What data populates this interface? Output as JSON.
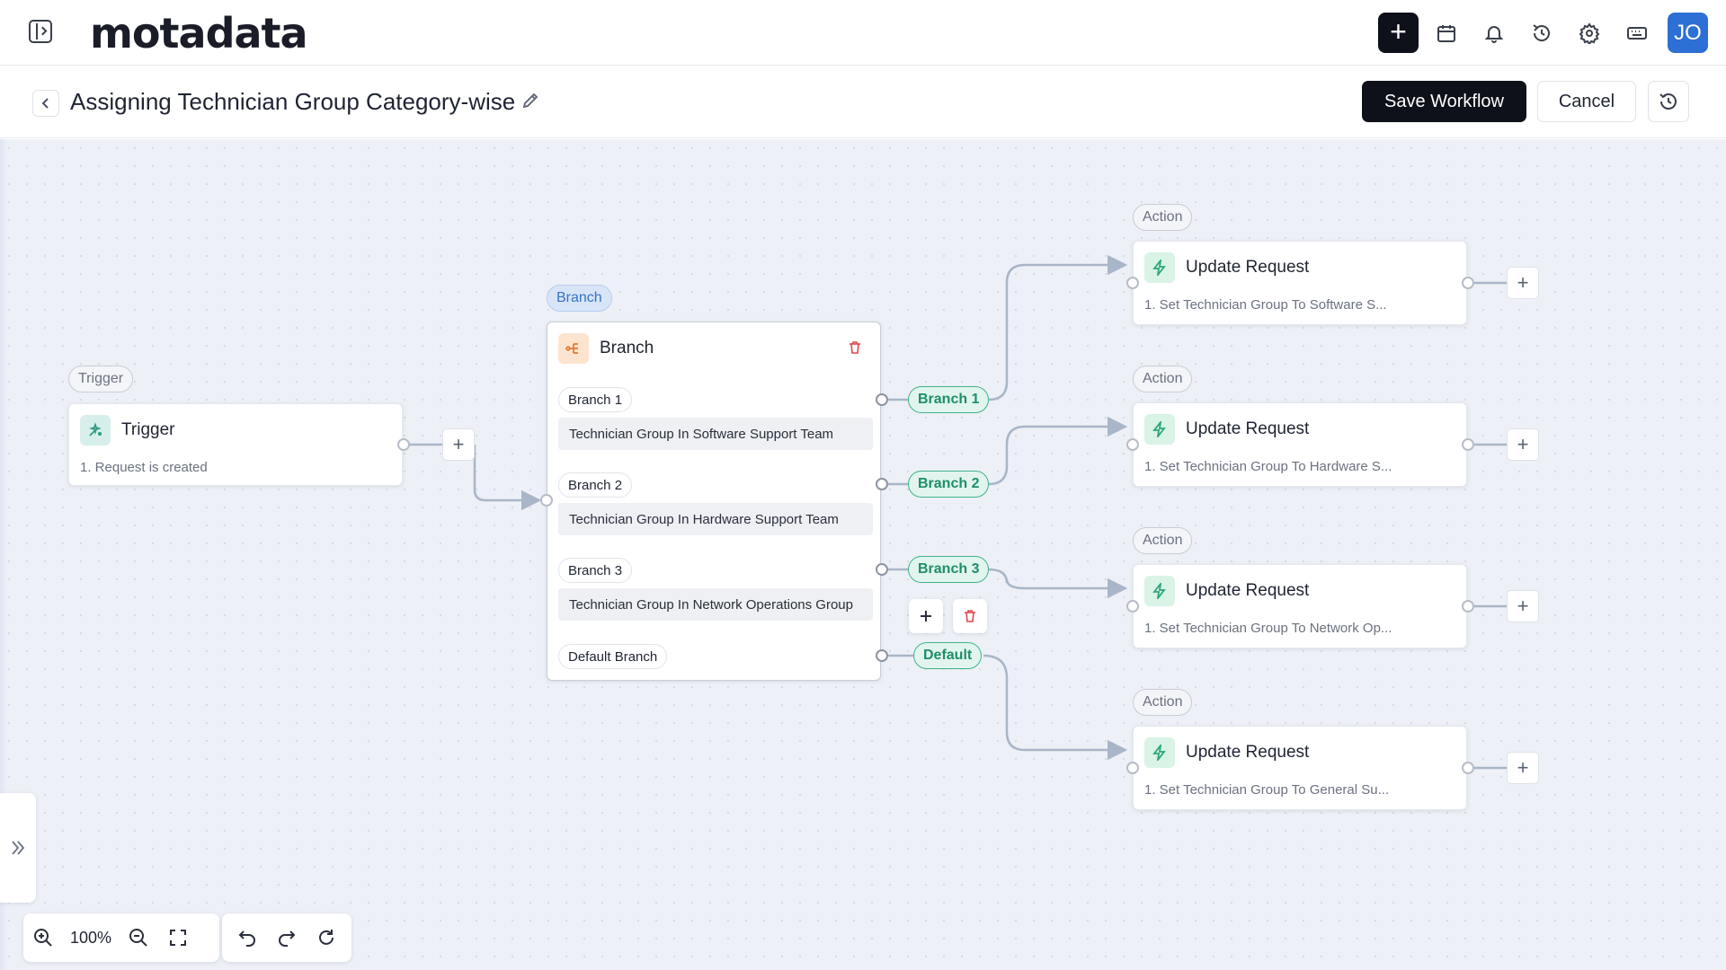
{
  "app": {
    "logo": "motadata",
    "avatar_initials": "JO"
  },
  "header": {
    "title": "Assigning Technician Group Category-wise",
    "save_label": "Save Workflow",
    "cancel_label": "Cancel"
  },
  "colors": {
    "primary_dark": "#0e111a",
    "avatar": "#2d6fd4",
    "branch_pill": "#1f8d6a",
    "delete": "#e0474c"
  },
  "icons": [
    "sidebar-toggle-icon",
    "plus-icon",
    "calendar-icon",
    "bell-icon",
    "timer-icon",
    "gear-icon",
    "keyboard-icon",
    "chevron-left-icon",
    "pencil-icon",
    "history-icon",
    "trash-icon",
    "bolt-icon",
    "branch-icon",
    "trigger-icon",
    "zoom-in-icon",
    "zoom-out-icon",
    "fullscreen-icon",
    "undo-icon",
    "redo-icon",
    "refresh-icon",
    "chevrons-right-icon"
  ],
  "trigger": {
    "tag": "Trigger",
    "title": "Trigger",
    "subtitle": "1. Request is created"
  },
  "branch": {
    "tag": "Branch",
    "title": "Branch",
    "items": [
      {
        "label": "Branch 1",
        "condition": "Technician Group In Software Support Team",
        "pill": "Branch 1"
      },
      {
        "label": "Branch 2",
        "condition": "Technician Group In Hardware Support Team",
        "pill": "Branch 2"
      },
      {
        "label": "Branch 3",
        "condition": "Technician Group In Network Operations Group",
        "pill": "Branch 3"
      }
    ],
    "default_label": "Default Branch",
    "default_pill": "Default"
  },
  "actions": [
    {
      "tag": "Action",
      "title": "Update Request",
      "subtitle": "1. Set Technician Group To Software S..."
    },
    {
      "tag": "Action",
      "title": "Update Request",
      "subtitle": "1. Set Technician Group To Hardware S..."
    },
    {
      "tag": "Action",
      "title": "Update Request",
      "subtitle": "1. Set Technician Group To Network Op..."
    },
    {
      "tag": "Action",
      "title": "Update Request",
      "subtitle": "1. Set Technician Group To General Su..."
    }
  ],
  "toolbar": {
    "zoom_level": "100%"
  }
}
